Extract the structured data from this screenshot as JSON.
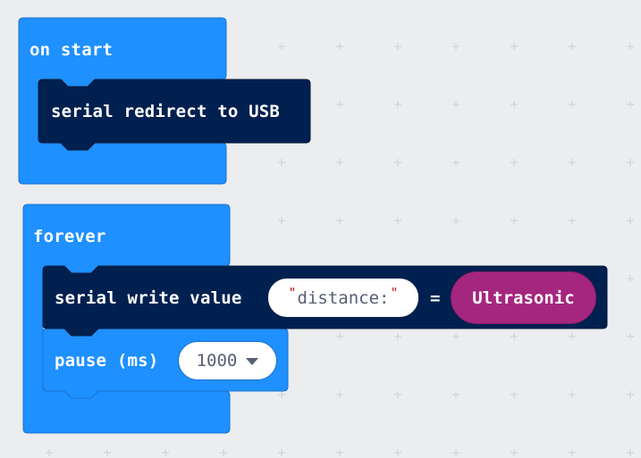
{
  "blocks": {
    "on_start": {
      "label": "on start",
      "serial_redirect": {
        "label": "serial redirect to USB"
      }
    },
    "forever": {
      "label": "forever",
      "serial_write_value": {
        "label": "serial write value",
        "name_value": "distance:",
        "equals": "=",
        "value_reporter": "Ultrasonic"
      },
      "pause": {
        "label": "pause (ms)",
        "duration": "1000"
      }
    }
  },
  "colors": {
    "workspace": "#ecedef",
    "grid_plus": "#d5d8dd",
    "basic_block": "#1e90ff",
    "serial_block": "#002050",
    "reporter": "#a5267f",
    "string_quote": "#d52323"
  },
  "icons": {
    "dropdown": "chevron-down-icon"
  }
}
